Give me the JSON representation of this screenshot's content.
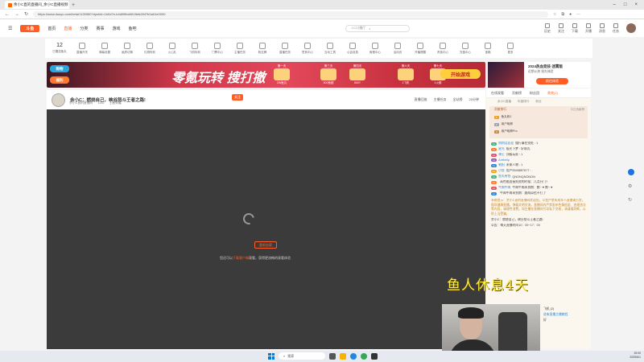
{
  "browser": {
    "tab_title": "余小C直的直播间_余小C直播视频",
    "url": "https://www.douyu.com/beta/1126960?dyshid=1b0d7e-b4d0f8bd4618eb2847b0a01e0000",
    "new_tab_icon": "+",
    "window_controls": [
      "–",
      "□",
      "×"
    ],
    "browser_icons": [
      "star-icon",
      "extensions-icon",
      "profile-icon",
      "menu-icon"
    ]
  },
  "site": {
    "logo_text": "斗鱼",
    "nav": [
      "首页",
      "直播",
      "分类",
      "赛事",
      "游戏",
      "鱼吧"
    ],
    "active_nav": "直播",
    "search_placeholder": "CC口播厅",
    "header_right": [
      "历史",
      "关注",
      "下载",
      "开播",
      "消息",
      "任务"
    ]
  },
  "categories": {
    "first_num": "12",
    "first_label": "已赠送鱼丸",
    "items": [
      "直播开关",
      "弹幕设置",
      "画质切换",
      "礼物特效",
      "火山礼",
      "飞机特效",
      "门票中心",
      "主播任务",
      "粉丝牌",
      "直播任务",
      "签到中心",
      "互动工具",
      "公会信息",
      "鱼粮中心",
      "活动页",
      "开播提醒",
      "贵族中心",
      "充值中心",
      "宝箱",
      "更多"
    ]
  },
  "banner": {
    "left_btn1": "购物",
    "left_btn2": "福利",
    "headline": "零氪玩转 搜打撤",
    "rewards": [
      {
        "day": "第一天",
        "label": "2W鱼丸"
      },
      {
        "day": "第三天",
        "label": "500鱼翅"
      },
      {
        "day": "第四天",
        "label": "500Y"
      },
      {
        "day": "第六天",
        "label": "1飞机"
      },
      {
        "day": "第七天",
        "label": "1火箭"
      }
    ],
    "start_label": "开始游戏",
    "colors": {
      "bg": "#d13849",
      "start": "#ffce3d"
    }
  },
  "promo": {
    "title": "2024热血竞技·迷雾版",
    "subtitle": "近期火热 抢先体验",
    "button": "前往体验"
  },
  "room": {
    "title": "余小C：燃烧自己，峡谷怒斗王者之路!",
    "follow_label": "关注",
    "meta": [
      "余小C直的直播间",
      "1132",
      "王者荣耀"
    ],
    "right": [
      "直播回放",
      "主播任务",
      "全站榜",
      "20分钟"
    ]
  },
  "player": {
    "replay_button": "重新加载",
    "hint_prefix": "您还可以",
    "hint_link": "下载客户端",
    "hint_suffix": "观看，获得更流畅的观看体验"
  },
  "chat": {
    "tabs": [
      "在线观看",
      "贡献榜",
      "粉丝团",
      "贵宾(2)"
    ],
    "active_tab": "贵宾(2)",
    "sub": [
      "余小C直播",
      "年度排行",
      "粉丝"
    ],
    "rank_header": "贡献排行",
    "rank_right": "今日贡献榜",
    "rank_rows": [
      "鱼丸粉1",
      "用户昵称",
      "用户昵称Pro"
    ],
    "messages": [
      {
        "name": "悄悄话丝丝",
        "text": "懂行事在别处 : 1"
      },
      {
        "name": "星光",
        "text": "极光下梦 : 好耶丸"
      },
      {
        "name": "骑士",
        "text": "顶级玩家 : 1"
      },
      {
        "name": "Anthelip",
        "text": ""
      },
      {
        "name": "朝阳",
        "text": "未来人物 : 1"
      },
      {
        "name": "小鱼",
        "text": "用户5545857677 : ."
      },
      {
        "name": "鱼丸有钱",
        "text": "QNONQNONON"
      },
      {
        "name": "",
        "text": "高性能连接失败的时候：几点开门?"
      },
      {
        "name": "牛肉牛肉",
        "text": "牛肉牛肉未到期：数~ ♥ 数~ ♥"
      },
      {
        "name": "",
        "text": "牛肉牛肉未到期：跟两局也不打了"
      }
    ],
    "system_notice": "系统提示：余小C直的直播间欢迎您，斗鱼严禁未成年人直播或打赏，倡导健康直播，弹幕文明交流。直播间内严禁发布色情低俗、违规违法等内容，请理性消费。如主播在直播间引导私下交易，请谨慎判断，以防上当受骗。",
    "tail": [
      "余小C：燃烧自己，峡谷怒斗王者之路!",
      "公告：每天直播时间10：00~17：00"
    ]
  },
  "overlay_text": "鱼人休息4天",
  "mini_chat": [
    "飞机 (2)",
    "进来直播主播教程",
    "好"
  ],
  "taskbar": {
    "search": "搜索",
    "time": "15:00",
    "date": "2025/6/1"
  }
}
